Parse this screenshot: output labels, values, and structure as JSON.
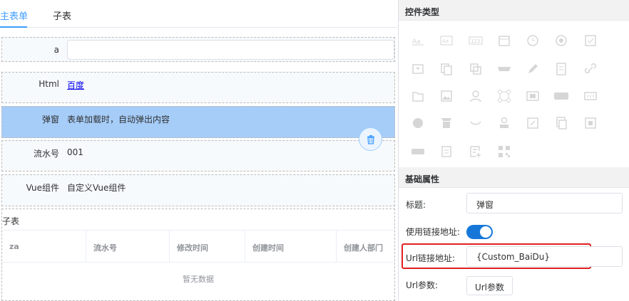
{
  "tabs": {
    "main": "主表单",
    "sub": "子表"
  },
  "form": {
    "rows": [
      {
        "label": "a",
        "value": ""
      },
      {
        "label": "Html",
        "value": "百度"
      },
      {
        "label": "弹窗",
        "value": "表单加载时，自动弹出内容"
      },
      {
        "label": "流水号",
        "value": "001"
      },
      {
        "label": "Vue组件",
        "value": "自定义Vue组件"
      }
    ],
    "subtable": {
      "title": "子表",
      "columns": [
        "za",
        "流水号",
        "修改时间",
        "创建时间",
        "创建人部门"
      ],
      "empty_text": "暂无数据"
    }
  },
  "panel": {
    "controls_title": "控件类型",
    "props_title": "基础属性",
    "title_label": "标题:",
    "title_value": "弹窗",
    "use_link_label": "使用链接地址:",
    "use_link_on": true,
    "url_label": "Url链接地址:",
    "url_value": "{Custom_BaiDu}",
    "url_params_label": "Url参数:",
    "url_params_button": "Url参数",
    "control_icons": [
      "text-icon",
      "textarea-icon",
      "number-icon",
      "date-icon",
      "time-icon",
      "radio-icon",
      "checkbox-icon",
      "select-icon",
      "copy-icon",
      "layers-icon",
      "tag-icon",
      "pen-icon",
      "document-icon",
      "link-icon",
      "folder-icon",
      "image-icon",
      "user-icon",
      "network-icon",
      "frame-icon",
      "html-icon",
      "code-icon",
      "circle-icon",
      "table-icon",
      "wave-icon",
      "stamp-icon",
      "edit-icon",
      "files-icon",
      "doc-icon",
      "label-icon",
      "calc-icon",
      "form-icon",
      "qrcode-icon"
    ]
  },
  "colors": {
    "accent": "#409eff",
    "selected_row": "#a6cdf8",
    "highlight": "#e02020",
    "switch_on": "#1677d9"
  }
}
